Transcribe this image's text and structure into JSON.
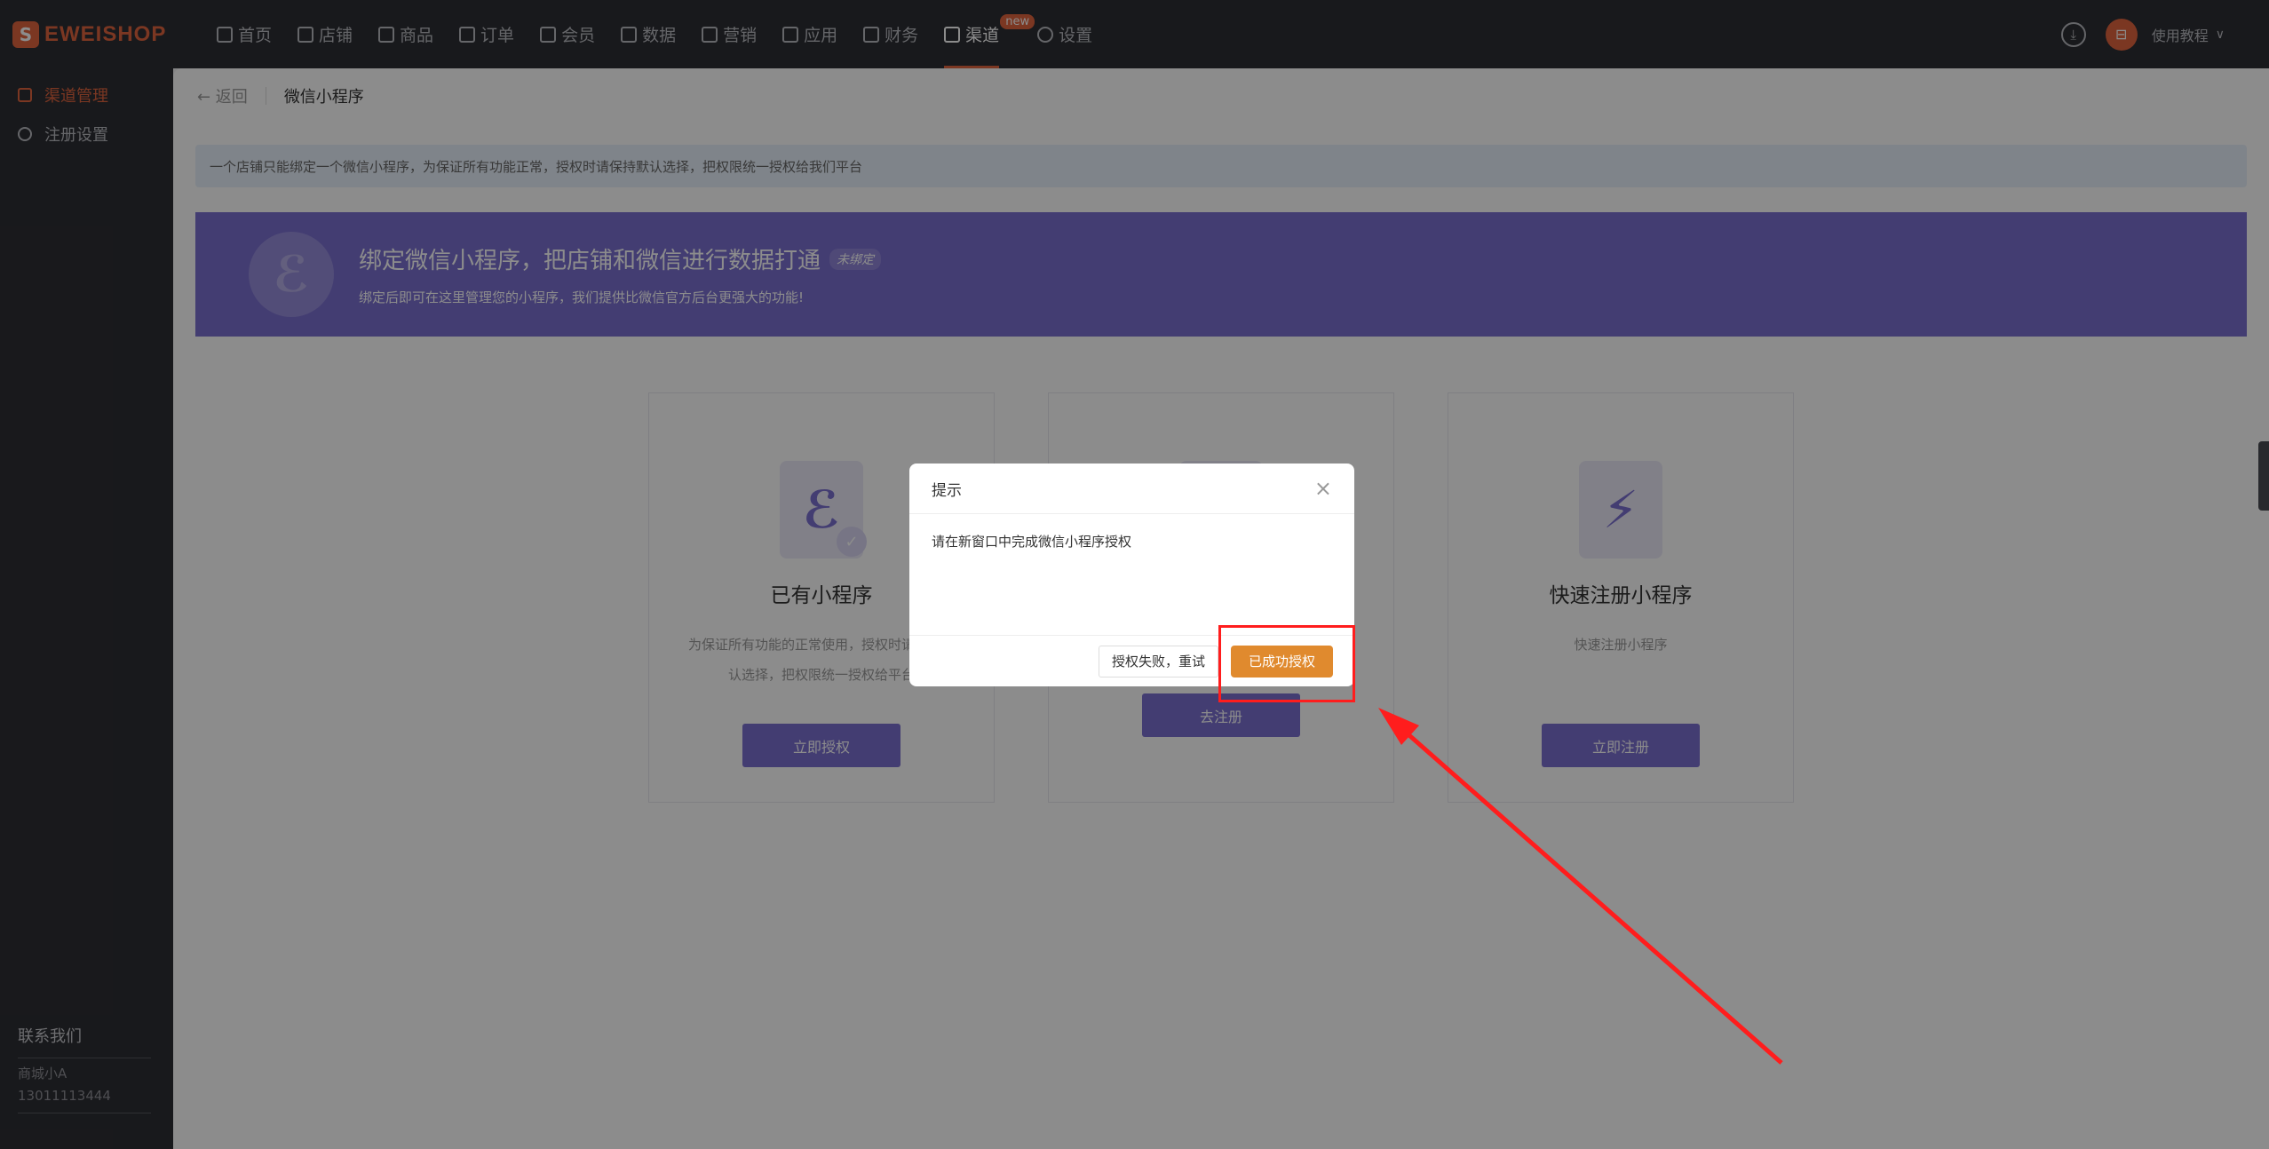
{
  "logo": {
    "mark": "S",
    "text": "EWEISHOP"
  },
  "nav": [
    {
      "label": "首页",
      "icon": "home-icon"
    },
    {
      "label": "店铺",
      "icon": "store-icon"
    },
    {
      "label": "商品",
      "icon": "goods-icon"
    },
    {
      "label": "订单",
      "icon": "order-icon"
    },
    {
      "label": "会员",
      "icon": "member-icon"
    },
    {
      "label": "数据",
      "icon": "chart-icon"
    },
    {
      "label": "营销",
      "icon": "tag-icon"
    },
    {
      "label": "应用",
      "icon": "app-icon"
    },
    {
      "label": "财务",
      "icon": "finance-icon"
    },
    {
      "label": "渠道",
      "icon": "channel-icon",
      "badge": "new"
    },
    {
      "label": "设置",
      "icon": "settings-icon"
    }
  ],
  "top_right": {
    "avatar": "⊟",
    "user_label": "使用教程",
    "caret": "∨",
    "download": "⤓"
  },
  "sidebar": {
    "items": [
      {
        "label": "渠道管理",
        "icon": "send-icon"
      },
      {
        "label": "注册设置",
        "icon": "user-settings-icon"
      }
    ],
    "contact_title": "联系我们",
    "contact_name": "商城小A",
    "contact_phone": "13011113444"
  },
  "breadcrumb": {
    "back": "← 返回",
    "title": "微信小程序"
  },
  "notice": "一个店铺只能绑定一个微信小程序，为保证所有功能正常，授权时请保持默认选择，把权限统一授权给我们平台",
  "banner": {
    "logo": "ℰ",
    "title": "绑定微信小程序，把店铺和微信进行数据打通",
    "tag": "未绑定",
    "subtitle": "绑定后即可在这里管理您的小程序，我们提供比微信官方后台更强大的功能!"
  },
  "cards": [
    {
      "title": "已有小程序",
      "desc": "为保证所有功能的正常使用，授权时请保持默认选择，把权限统一授权给平台",
      "button": "立即授权",
      "glyph": "ℰ",
      "check": "✓"
    },
    {
      "title": "",
      "desc": "",
      "button": "去注册",
      "glyph": "",
      "check": ""
    },
    {
      "title": "快速注册小程序",
      "desc": "快速注册小程序",
      "button": "立即注册",
      "glyph": "⚡",
      "check": ""
    }
  ],
  "modal": {
    "title": "提示",
    "close": "×",
    "body": "请在新窗口中完成微信小程序授权",
    "retry": "授权失败，重试",
    "confirm": "已成功授权"
  },
  "colors": {
    "accent": "#e0643f",
    "primary": "#7b6fd0",
    "confirm": "#e08a2e",
    "annotation": "#ff1d1d"
  }
}
